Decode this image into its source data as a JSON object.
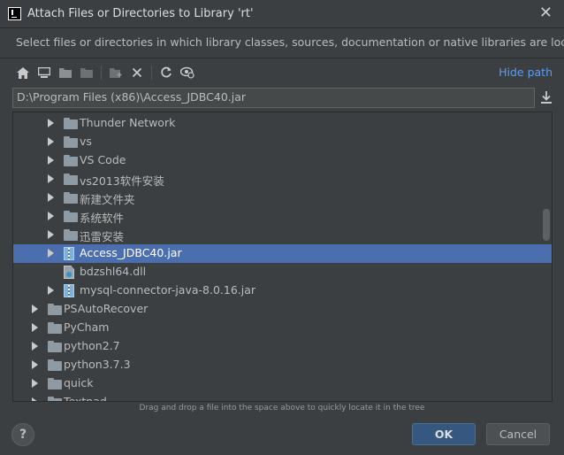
{
  "dialog": {
    "title": "Attach Files or Directories to Library 'rt'",
    "description": "Select files or directories in which library classes, sources, documentation or native libraries are located"
  },
  "toolbar": {
    "icons": [
      "home-icon",
      "desktop-icon",
      "new-folder-icon",
      "folder-up-icon",
      "add-icon",
      "delete-icon",
      "refresh-icon",
      "show-hidden-icon"
    ],
    "hide_path_label": "Hide path"
  },
  "path": {
    "value": "D:\\Program Files (x86)\\Access_JDBC40.jar"
  },
  "tree": {
    "rows": [
      {
        "label": "Thunder Network",
        "type": "folder",
        "expandable": true,
        "selected": false,
        "level": 2
      },
      {
        "label": "vs",
        "type": "folder",
        "expandable": true,
        "selected": false,
        "level": 2
      },
      {
        "label": "VS Code",
        "type": "folder",
        "expandable": true,
        "selected": false,
        "level": 2
      },
      {
        "label": "vs2013软件安装",
        "type": "folder",
        "expandable": true,
        "selected": false,
        "level": 2
      },
      {
        "label": "新建文件夹",
        "type": "folder",
        "expandable": true,
        "selected": false,
        "level": 2
      },
      {
        "label": "系统软件",
        "type": "folder",
        "expandable": true,
        "selected": false,
        "level": 2
      },
      {
        "label": "迅雷安装",
        "type": "folder",
        "expandable": true,
        "selected": false,
        "level": 2
      },
      {
        "label": "Access_JDBC40.jar",
        "type": "jar",
        "expandable": true,
        "selected": true,
        "level": 2
      },
      {
        "label": "bdzshl64.dll",
        "type": "dll",
        "expandable": false,
        "selected": false,
        "level": 2
      },
      {
        "label": "mysql-connector-java-8.0.16.jar",
        "type": "jar",
        "expandable": true,
        "selected": false,
        "level": 2
      },
      {
        "label": "PSAutoRecover",
        "type": "folder",
        "expandable": true,
        "selected": false,
        "level": 1
      },
      {
        "label": "PyCham",
        "type": "folder",
        "expandable": true,
        "selected": false,
        "level": 1
      },
      {
        "label": "python2.7",
        "type": "folder",
        "expandable": true,
        "selected": false,
        "level": 1
      },
      {
        "label": "python3.7.3",
        "type": "folder",
        "expandable": true,
        "selected": false,
        "level": 1
      },
      {
        "label": "quick",
        "type": "folder",
        "expandable": true,
        "selected": false,
        "level": 1
      },
      {
        "label": "Textpad",
        "type": "folder",
        "expandable": true,
        "selected": false,
        "level": 1
      }
    ]
  },
  "hint": "Drag and drop a file into the space above to quickly locate it in the tree",
  "buttons": {
    "help": "?",
    "ok": "OK",
    "cancel": "Cancel"
  },
  "colors": {
    "background": "#3c3f41",
    "selection": "#4b6eaf",
    "link": "#589df6",
    "ok_button": "#365880"
  }
}
